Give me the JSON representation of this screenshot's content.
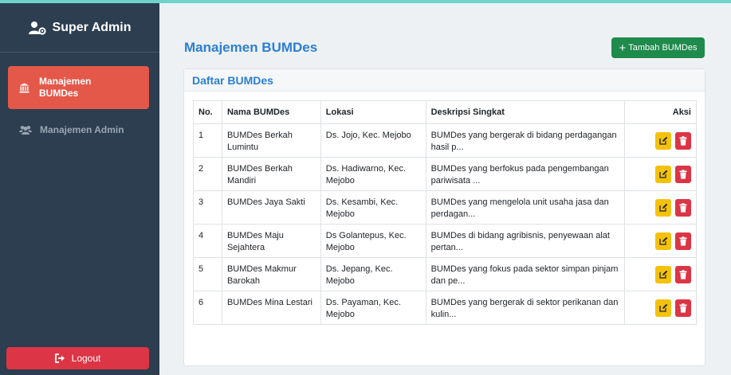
{
  "sidebar": {
    "brand": "Super Admin",
    "items": [
      {
        "label": "Manajemen BUMDes",
        "active": true
      },
      {
        "label": "Manajemen Admin",
        "active": false
      }
    ],
    "logout": "Logout"
  },
  "main": {
    "title": "Manajemen BUMDes",
    "add_button": "Tambah BUMDes",
    "add_icon": "+",
    "card_title": "Daftar BUMDes",
    "table": {
      "headers": [
        "No.",
        "Nama BUMDes",
        "Lokasi",
        "Deskripsi Singkat",
        "Aksi"
      ],
      "rows": [
        {
          "no": "1",
          "name": "BUMDes Berkah Lumintu",
          "location": "Ds. Jojo, Kec. Mejobo",
          "desc": "BUMDes yang bergerak di bidang perdagangan hasil p..."
        },
        {
          "no": "2",
          "name": "BUMDes Berkah Mandiri",
          "location": "Ds. Hadiwarno, Kec. Mejobo",
          "desc": "BUMDes yang berfokus pada pengembangan pariwisata ..."
        },
        {
          "no": "3",
          "name": "BUMDes Jaya Sakti",
          "location": "Ds. Kesambi, Kec. Mejobo",
          "desc": "BUMDes yang mengelola unit usaha jasa dan perdagan..."
        },
        {
          "no": "4",
          "name": "BUMDes Maju Sejahtera",
          "location": "Ds Golantepus, Kec. Mejobo",
          "desc": "BUMDes di bidang agribisnis, penyewaan alat pertan..."
        },
        {
          "no": "5",
          "name": "BUMDes Makmur Barokah",
          "location": "Ds. Jepang, Kec. Mejobo",
          "desc": "BUMDes yang fokus pada sektor simpan pinjam dan pe..."
        },
        {
          "no": "6",
          "name": "BUMDes Mina Lestari",
          "location": "Ds. Payaman, Kec. Mejobo",
          "desc": "BUMDes yang bergerak di sektor perikanan dan kulin..."
        }
      ]
    }
  },
  "colors": {
    "sidebar_bg": "#2c3e50",
    "active_item": "#e4584a",
    "logout": "#dc3545",
    "add_button": "#1e8a4c",
    "accent_title": "#2a7fd4",
    "edit_button": "#f4c20d",
    "delete_button": "#dc3545"
  },
  "icons": {
    "brand": "user-cog-icon",
    "menu_bumdes": "bank-icon",
    "menu_admin": "users-icon",
    "logout": "sign-out-icon",
    "edit": "edit-icon",
    "delete": "trash-icon"
  }
}
